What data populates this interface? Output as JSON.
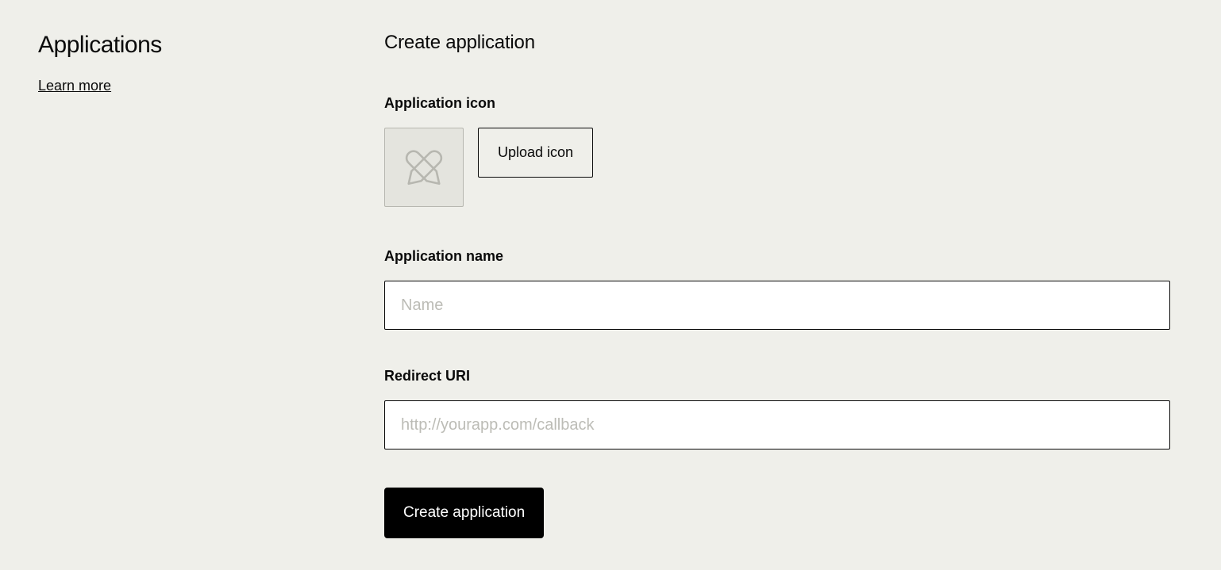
{
  "sidebar": {
    "title": "Applications",
    "learn_more": "Learn more"
  },
  "main": {
    "title": "Create application",
    "icon_section_label": "Application icon",
    "upload_label": "Upload icon",
    "name_label": "Application name",
    "name_placeholder": "Name",
    "name_value": "",
    "redirect_label": "Redirect URI",
    "redirect_placeholder": "http://yourapp.com/callback",
    "redirect_value": "",
    "submit_label": "Create application"
  }
}
